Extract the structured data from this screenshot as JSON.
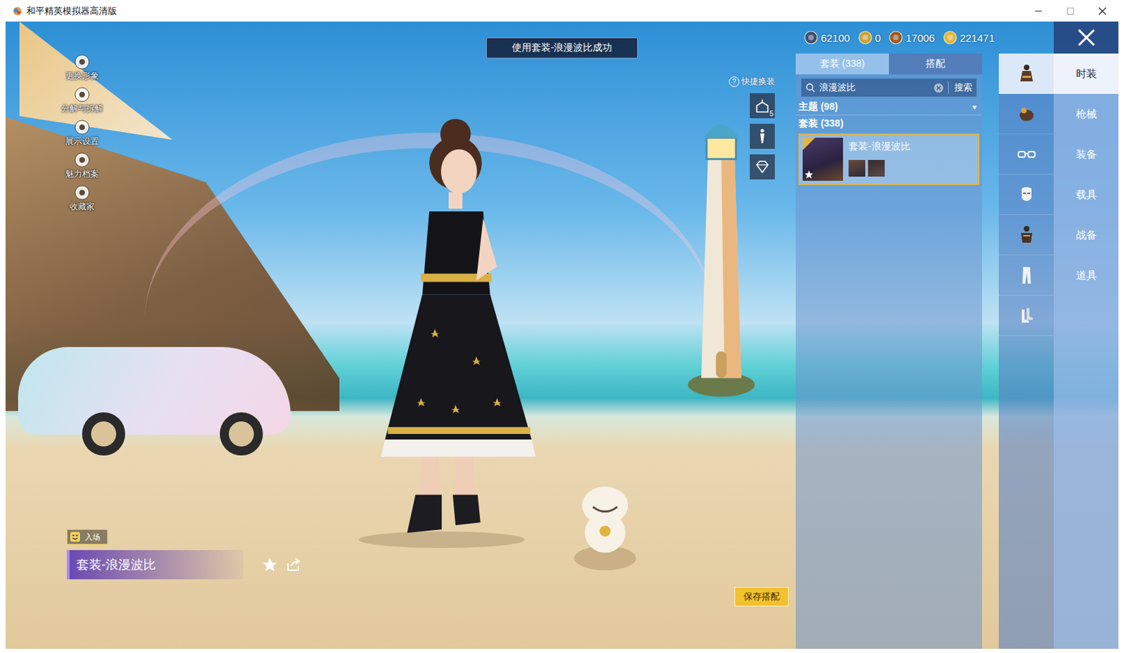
{
  "window": {
    "title": "和平精英模拟器高清版"
  },
  "left_menu": [
    {
      "label": "更换形象"
    },
    {
      "label": "分解与拆解"
    },
    {
      "label": "展示设置"
    },
    {
      "label": "魅力档案"
    },
    {
      "label": "收藏家"
    }
  ],
  "toast": "使用套装-浪漫波比成功",
  "currencies": [
    {
      "amount": "62100",
      "color": "#3d4e72"
    },
    {
      "amount": "0",
      "color": "#c9a23a"
    },
    {
      "amount": "17006",
      "color": "#9a5a2a"
    },
    {
      "amount": "221471",
      "color": "#e3b53c"
    }
  ],
  "quick_dress": {
    "label": "快捷换装",
    "help": "?",
    "buttons": [
      {
        "kind": "hanger",
        "badge": "5"
      },
      {
        "kind": "figure",
        "badge": ""
      },
      {
        "kind": "diamond",
        "badge": ""
      }
    ]
  },
  "panel": {
    "tabs": [
      {
        "label": "套装 (338)",
        "selected": true
      },
      {
        "label": "搭配",
        "selected": false
      }
    ],
    "search": {
      "value": "浪漫波比",
      "button": "搜索"
    },
    "filter": {
      "label": "主题 (98)",
      "arrow": "▾"
    },
    "section": "套装 (338)",
    "items": [
      {
        "name": "套装-浪漫波比",
        "selected": true
      }
    ]
  },
  "categories": [
    {
      "kind": "outfit",
      "selected": true
    },
    {
      "kind": "hat",
      "selected": false
    },
    {
      "kind": "glasses",
      "selected": false
    },
    {
      "kind": "mask",
      "selected": false
    },
    {
      "kind": "top",
      "selected": false
    },
    {
      "kind": "pants",
      "selected": false
    },
    {
      "kind": "shoes",
      "selected": false
    }
  ],
  "tabs": [
    {
      "label": "时装",
      "selected": true
    },
    {
      "label": "枪械",
      "selected": false
    },
    {
      "label": "装备",
      "selected": false
    },
    {
      "label": "载具",
      "selected": false
    },
    {
      "label": "战备",
      "selected": false
    },
    {
      "label": "道具",
      "selected": false
    }
  ],
  "entrance": {
    "label": "入场"
  },
  "current_outfit": {
    "name": "套装-浪漫波比"
  },
  "save_button": "保存搭配"
}
